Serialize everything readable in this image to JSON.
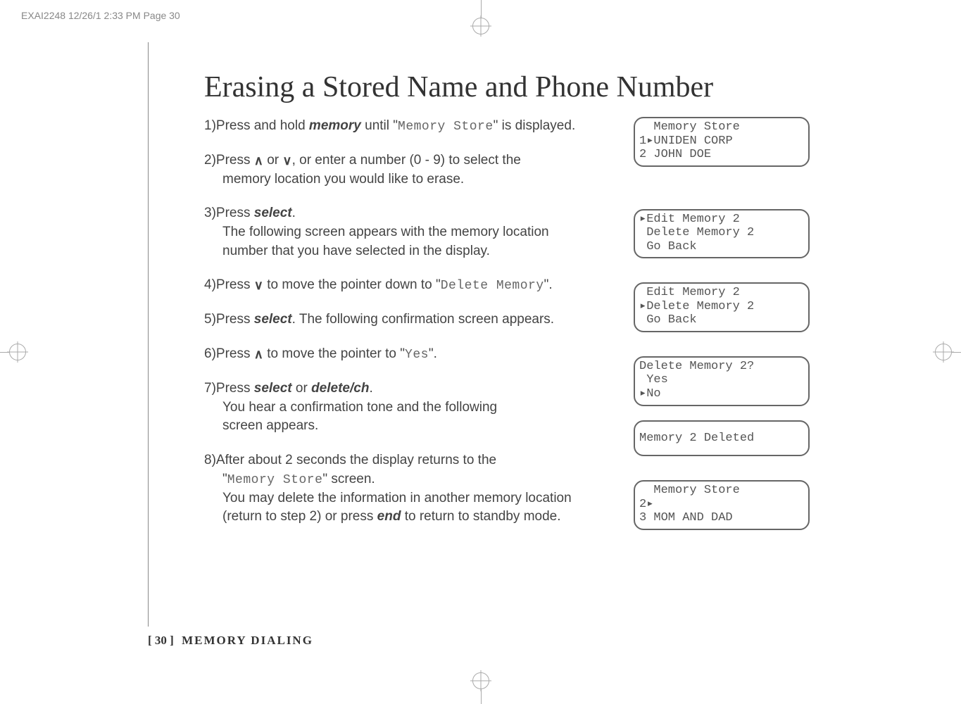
{
  "header": "EXAI2248  12/26/1 2:33 PM  Page 30",
  "title": "Erasing a Stored Name and Phone Number",
  "steps": {
    "s1_a": "1)Press and hold ",
    "s1_b": "memory",
    "s1_c": " until \"",
    "s1_d": "Memory Store",
    "s1_e": "\" is displayed.",
    "s2_a": "2)Press ",
    "s2_b": " or ",
    "s2_c": ", or enter a number (0 - 9) to select the",
    "s2_d": "memory location you would like to erase.",
    "s3_a": "3)Press ",
    "s3_b": "select",
    "s3_c": ".",
    "s3_d": "The following screen appears with the memory location",
    "s3_e": "number that you have selected in the display.",
    "s4_a": "4)Press ",
    "s4_b": " to move the pointer down to \"",
    "s4_c": "Delete Memory",
    "s4_d": "\".",
    "s5_a": "5)Press ",
    "s5_b": "select",
    "s5_c": ". The following confirmation screen appears.",
    "s6_a": "6)Press ",
    "s6_b": " to move the pointer to \"",
    "s6_c": "Yes",
    "s6_d": "\".",
    "s7_a": "7)Press ",
    "s7_b": "select",
    "s7_c": " or ",
    "s7_d": "delete/ch",
    "s7_e": ".",
    "s7_f": "You hear a confirmation tone and the following",
    "s7_g": "screen appears.",
    "s8_a": "8)After about 2 seconds the display returns to the",
    "s8_b": "\"",
    "s8_c": "Memory Store",
    "s8_d": "\" screen.",
    "s8_e": "You may delete the information in another memory location",
    "s8_f": "(return to step 2) or press ",
    "s8_g": "end",
    "s8_h": " to return to standby mode."
  },
  "lcd": {
    "d1": "  Memory Store\n1▸UNIDEN CORP\n2 JOHN DOE",
    "d2": "▸Edit Memory 2\n Delete Memory 2\n Go Back",
    "d3": " Edit Memory 2\n▸Delete Memory 2\n Go Back",
    "d4": "Delete Memory 2?\n Yes\n▸No",
    "d5": "Memory 2 Deleted",
    "d6": "  Memory Store\n2▸\n3 MOM AND DAD"
  },
  "footer": {
    "page": "[ 30 ]",
    "section": "MEMORY DIALING"
  },
  "glyphs": {
    "up": "∧",
    "down": "∨"
  }
}
